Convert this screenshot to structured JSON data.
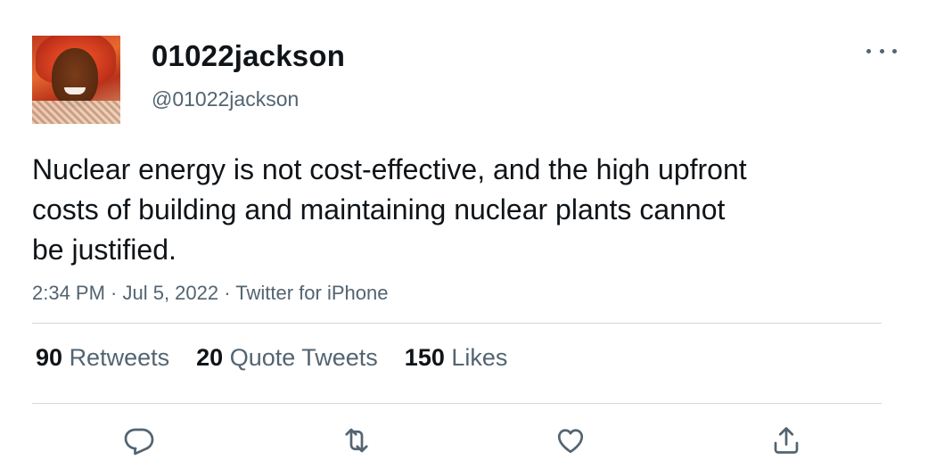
{
  "author": {
    "display_name": "01022jackson",
    "handle": "@01022jackson"
  },
  "tweet": {
    "text": "Nuclear energy is not cost-effective, and the high upfront costs of building and maintaining nuclear plants cannot be justified.",
    "meta": "2:34 PM · Jul 5, 2022 · Twitter for iPhone"
  },
  "stats": {
    "retweets_count": "90",
    "retweets_label": "Retweets",
    "quotes_count": "20",
    "quotes_label": "Quote Tweets",
    "likes_count": "150",
    "likes_label": "Likes"
  },
  "icons": {
    "more": "more-options-icon",
    "reply": "reply-icon",
    "retweet": "retweet-icon",
    "like": "heart-icon",
    "share": "share-icon"
  },
  "colors": {
    "text_primary": "#0f1419",
    "text_secondary": "#536471",
    "divider": "#cfd9de"
  }
}
